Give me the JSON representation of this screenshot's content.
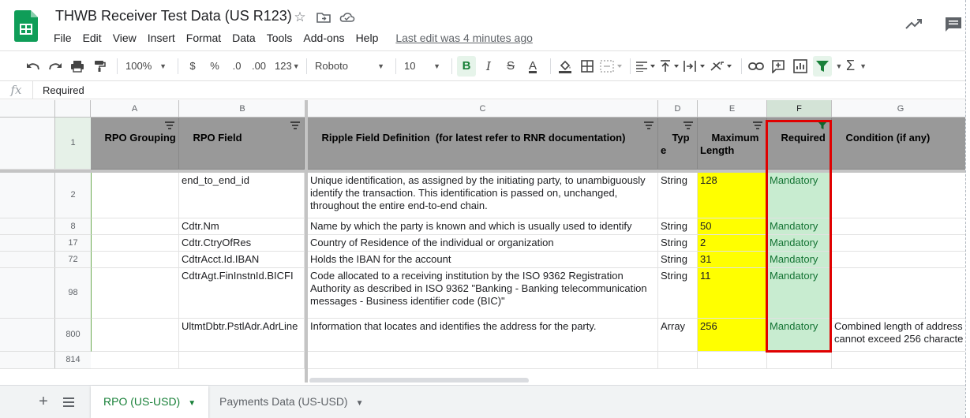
{
  "app": {
    "title": "THWB Receiver Test Data (US R123)",
    "last_edit": "Last edit was 4 minutes ago"
  },
  "menu": [
    "File",
    "Edit",
    "View",
    "Insert",
    "Format",
    "Data",
    "Tools",
    "Add-ons",
    "Help"
  ],
  "toolbar": {
    "zoom": "100%",
    "currency": "$",
    "percent": "%",
    "dec_less": ".0",
    "dec_more": ".00",
    "format_more": "123",
    "font": "Roboto",
    "font_size": "10",
    "bold": "B",
    "italic": "I",
    "strike": "S",
    "text_color": "A"
  },
  "formula_bar": {
    "fx": "fx",
    "value": "Required"
  },
  "columns": [
    "A",
    "B",
    "C",
    "D",
    "E",
    "F",
    "G"
  ],
  "header_row": {
    "row_num": "1",
    "cells": [
      "RPO Grouping",
      "RPO Field",
      "Ripple Field Definition  (for latest refer to RNR documentation)",
      "Typ\ne",
      "Maximum\nLength",
      "Required",
      "Condition (if any)"
    ]
  },
  "rows": [
    {
      "num": "2",
      "cells": [
        "",
        "end_to_end_id",
        "Unique identification, as assigned by the initiating party, to unambiguously identify the transaction. This identification is passed on, unchanged, throughout the entire end-to-end chain.",
        "String",
        "128",
        "Mandatory",
        ""
      ]
    },
    {
      "num": "8",
      "cells": [
        "",
        "Cdtr.Nm",
        "Name by which the party is known and which is usually used to identify",
        "String",
        "50",
        "Mandatory",
        ""
      ]
    },
    {
      "num": "17",
      "cells": [
        "",
        "Cdtr.CtryOfRes",
        "Country of Residence of the individual or organization",
        "String",
        "2",
        "Mandatory",
        ""
      ]
    },
    {
      "num": "72",
      "cells": [
        "",
        "CdtrAcct.Id.IBAN",
        "Holds the IBAN for the account",
        "String",
        "31",
        "Mandatory",
        ""
      ]
    },
    {
      "num": "98",
      "cells": [
        "",
        "CdtrAgt.FinInstnId.BICFI",
        "Code allocated to a receiving institution by the ISO 9362 Registration Authority as described in ISO 9362 \"Banking - Banking telecommunication messages - Business identifier code (BIC)\"",
        "String",
        "11",
        "Mandatory",
        ""
      ]
    },
    {
      "num": "800",
      "cells": [
        "",
        "UltmtDbtr.PstlAdr.AdrLine",
        "Information that locates and identifies the address for the party.",
        "Array",
        "256",
        "Mandatory",
        "Combined length of address\ncannot exceed 256 characte"
      ]
    },
    {
      "num": "814",
      "cells": [
        "",
        "",
        "",
        "",
        "",
        "",
        ""
      ]
    }
  ],
  "sheets": [
    {
      "label": "RPO (US-USD)",
      "active": true
    },
    {
      "label": "Payments Data (US-USD)",
      "active": false
    }
  ],
  "colors": {
    "header_gray": "#999999",
    "yellow": "#ffff00",
    "green_fill": "#c8ecd0",
    "accent_green": "#188038",
    "highlight_red": "#e00000"
  }
}
